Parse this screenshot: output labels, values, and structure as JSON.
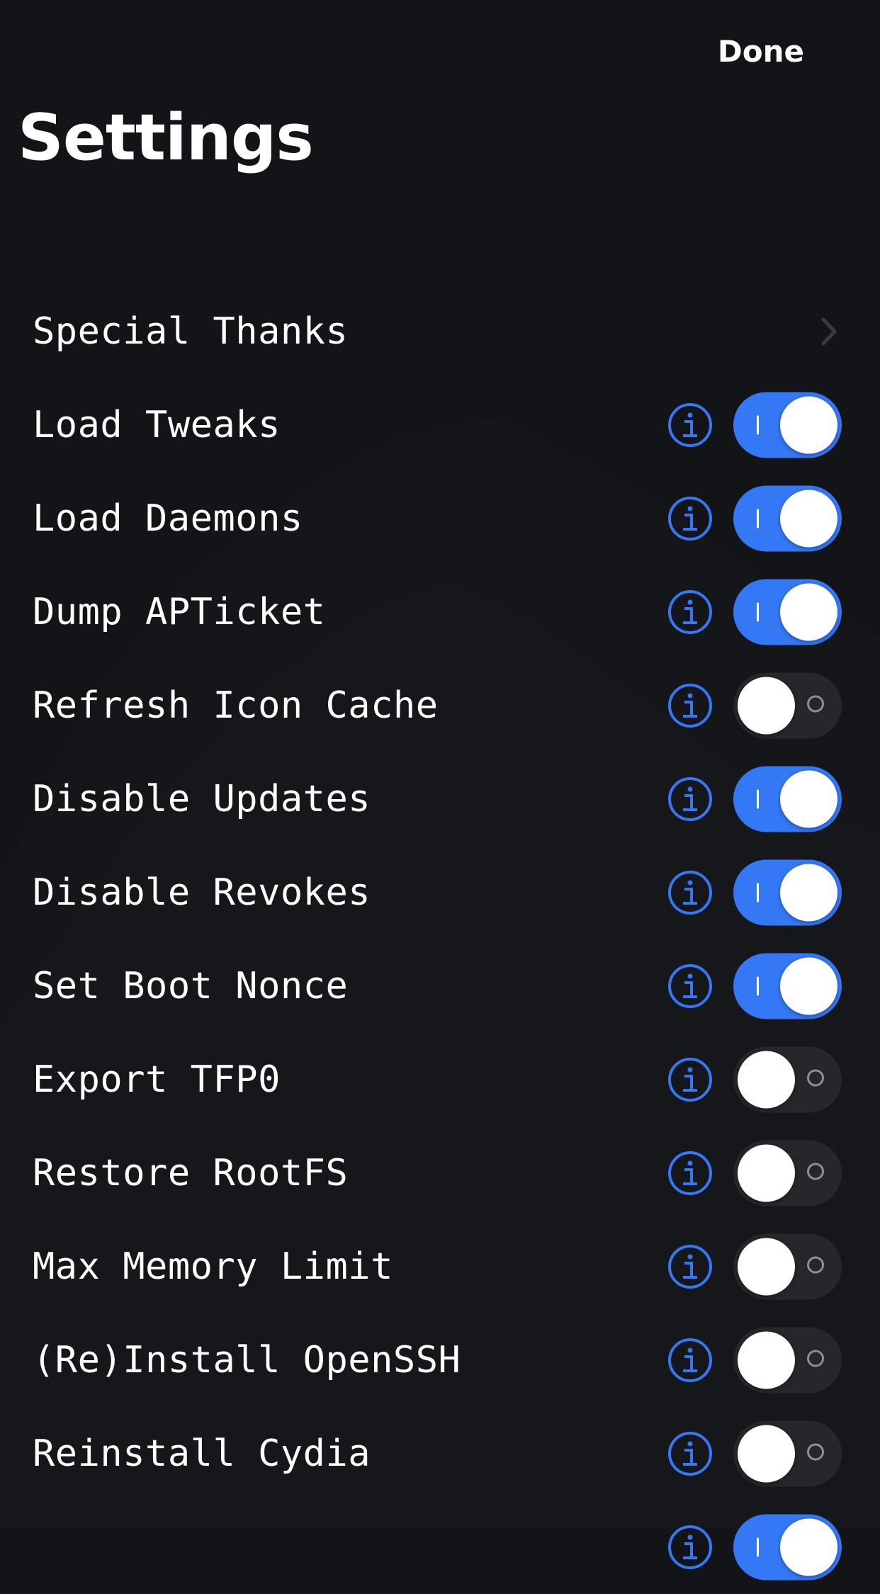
{
  "header": {
    "done_label": "Done",
    "title": "Settings"
  },
  "colors": {
    "accent": "#3478f6",
    "background": "#131417",
    "toggle_off_track": "#26272b"
  },
  "settings": {
    "rows": [
      {
        "label": "Special Thanks",
        "type": "link",
        "icon": "chevron-right-icon"
      },
      {
        "label": "Load Tweaks",
        "type": "toggle",
        "on": true
      },
      {
        "label": "Load Daemons",
        "type": "toggle",
        "on": true
      },
      {
        "label": "Dump APTicket",
        "type": "toggle",
        "on": true
      },
      {
        "label": "Refresh Icon Cache",
        "type": "toggle",
        "on": false
      },
      {
        "label": "Disable Updates",
        "type": "toggle",
        "on": true
      },
      {
        "label": "Disable Revokes",
        "type": "toggle",
        "on": true
      },
      {
        "label": "Set Boot Nonce",
        "type": "toggle",
        "on": true
      },
      {
        "label": "Export TFP0",
        "type": "toggle",
        "on": false
      },
      {
        "label": "Restore RootFS",
        "type": "toggle",
        "on": false
      },
      {
        "label": "Max Memory Limit",
        "type": "toggle",
        "on": false
      },
      {
        "label": "(Re)Install OpenSSH",
        "type": "toggle",
        "on": false
      },
      {
        "label": "Reinstall Cydia",
        "type": "toggle",
        "on": false
      },
      {
        "label": "",
        "type": "toggle",
        "on": true
      }
    ]
  }
}
